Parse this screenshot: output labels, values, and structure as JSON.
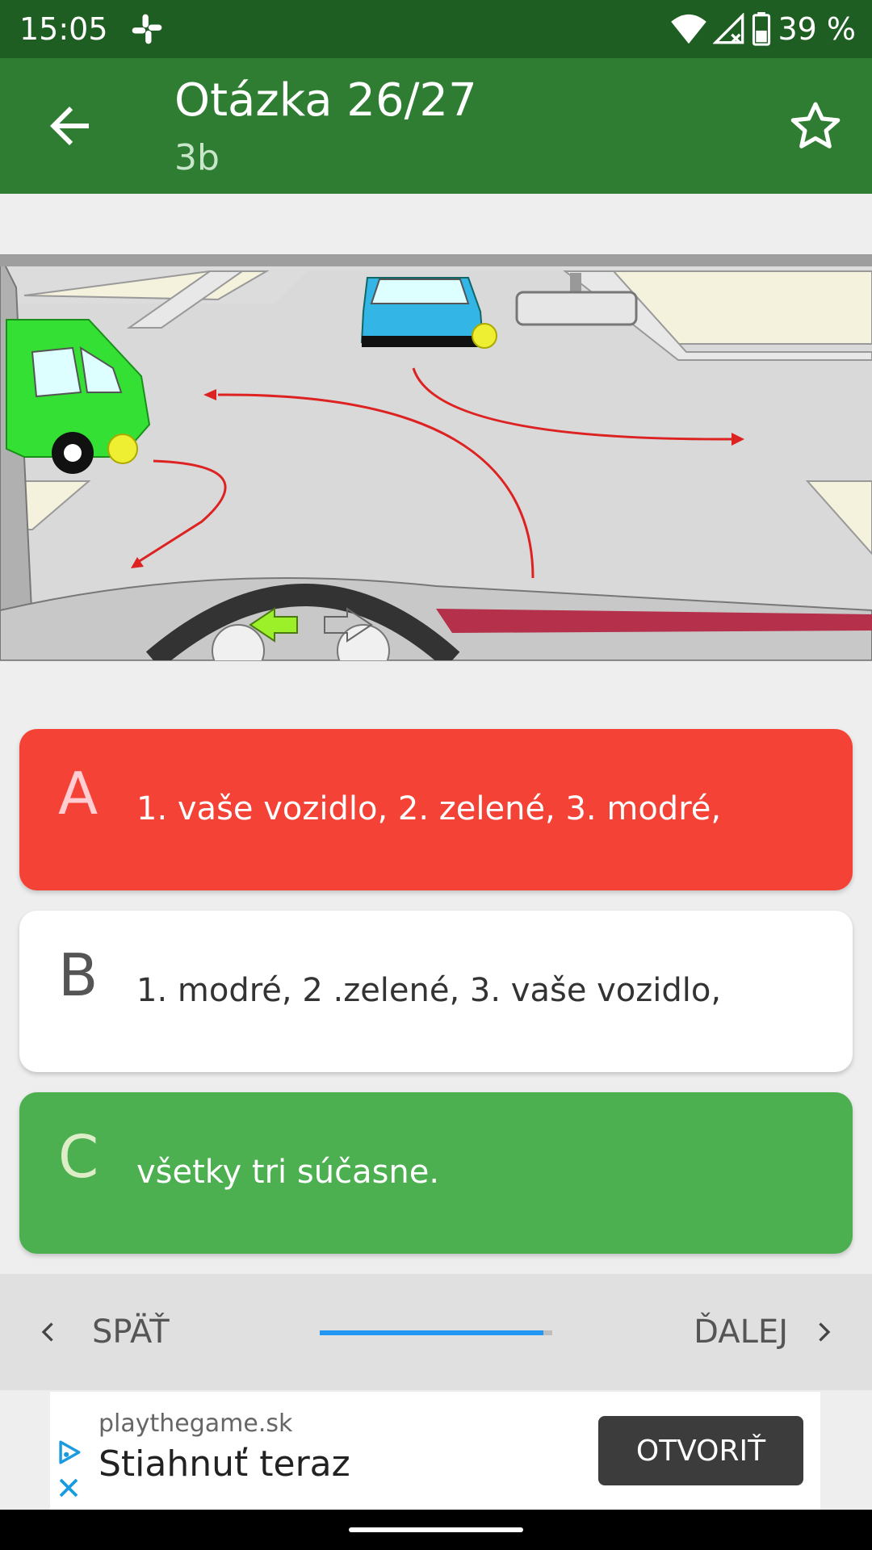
{
  "status_bar": {
    "time": "15:05",
    "battery": "39 %",
    "icons": [
      "slack-icon",
      "wifi-icon",
      "signal-icon",
      "battery-icon"
    ]
  },
  "app_bar": {
    "title": "Otázka 26/27",
    "subtitle": "3b",
    "icons": [
      "arrow-back-icon",
      "star-outline-icon"
    ]
  },
  "question_image": {
    "description_icon": "intersection-scene"
  },
  "answers": [
    {
      "letter": "A",
      "text": "1. vaše vozidlo, 2. zelené, 3. modré,",
      "color": "#f44336"
    },
    {
      "letter": "B",
      "text": "1. modré, 2 .zelené, 3. vaše vozidlo,",
      "color": "#ffffff"
    },
    {
      "letter": "C",
      "text": "všetky tri súčasne.",
      "color": "#4caf50"
    }
  ],
  "navigation": {
    "prev_label": "SPÄŤ",
    "next_label": "ĎALEJ",
    "progress": 0.963
  },
  "ad": {
    "domain": "playthegame.sk",
    "headline": "Stiahnuť teraz",
    "button_label": "OTVORIŤ"
  },
  "colors": {
    "status_bar": "#1f5e22",
    "app_bar": "#2e7d32",
    "wrong": "#f44336",
    "correct": "#4caf50",
    "progress": "#2196f3"
  }
}
